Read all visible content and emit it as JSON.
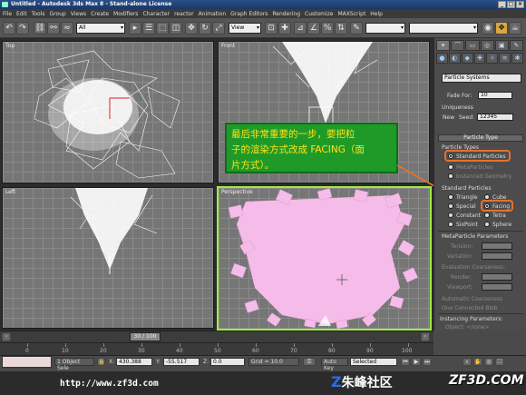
{
  "titlebar": {
    "text": "Untitled - Autodesk 3ds Max 8 - Stand-alone License",
    "btn_min": "_",
    "btn_max": "□",
    "btn_close": "×"
  },
  "menu": [
    "File",
    "Edit",
    "Tools",
    "Group",
    "Views",
    "Create",
    "Modifiers",
    "Character",
    "reactor",
    "Animation",
    "Graph Editors",
    "Rendering",
    "Customize",
    "MAXScript",
    "Help"
  ],
  "toolbar": {
    "selection_filter": "All",
    "view_dropdown": "View"
  },
  "viewports": {
    "top": "Top",
    "front": "Front",
    "left": "Left",
    "perspective": "Perspective"
  },
  "callout": {
    "line1": "最后非常重要的一步，要把粒",
    "line2": "子的渲染方式改成 FACING（面",
    "line3": "片方式）。"
  },
  "command_panel": {
    "tabs": [
      "✦",
      "⌒",
      "▭",
      "◎",
      "▣",
      "✎"
    ],
    "icons": [
      "●",
      "◐",
      "◆",
      "✚",
      "☼",
      "≋",
      "✱"
    ],
    "category": "Particle Systems",
    "fade_for_label": "Fade For:",
    "fade_for_value": "10",
    "uniqueness_label": "Uniqueness",
    "new_label": "New",
    "seed_label": "Seed:",
    "seed_value": "12345",
    "particle_type_rollout": "Particle Type",
    "particle_types_label": "Particle Types",
    "standard_particles": "Standard Particles",
    "metaparticles": "MetaParticles",
    "instanced_geometry": "Instanced Geometry",
    "standard_particles_group": "Standard Particles",
    "triangle": "Triangle",
    "cube": "Cube",
    "special": "Special",
    "facing": "Facing",
    "constant": "Constant",
    "tetra": "Tetra",
    "sixpoint": "SixPoint",
    "sphere": "Sphere",
    "meta_params_label": "MetaParticle Parameters",
    "tension_label": "Tension:",
    "variation_label": "Variation:",
    "eval_coarseness": "Evaluation Coarseness:",
    "render_label": "Render:",
    "viewport_label": "Viewport:",
    "auto_coarseness": "Automatic Coarseness",
    "one_connected": "One Connected Blob",
    "instancing_label": "Instancing Parameters:",
    "object_label": "Object: <none>"
  },
  "timeslider": {
    "label": "30 / 100"
  },
  "trackbar_ticks": [
    "0",
    "10",
    "20",
    "30",
    "40",
    "50",
    "60",
    "70",
    "80",
    "90",
    "100"
  ],
  "status": {
    "selected": "1 Object Sele",
    "x_value": "430.388",
    "y_value": "-55.517",
    "z_value": "0.0",
    "grid": "Grid = 10.0",
    "auto_key": "Auto Key",
    "selected_dd": "Selected"
  },
  "footer": {
    "url": "http://www.zf3d.com",
    "brand_mark": "Z",
    "brand_text": "朱峰社区",
    "logo": "ZF3D.COM"
  },
  "colors": {
    "callout_bg": "#1f9a28",
    "callout_text": "#ffe11a",
    "highlight": "#e8712a",
    "active_viewport": "#9eec3f",
    "particle_pink": "#f5bbe9"
  }
}
